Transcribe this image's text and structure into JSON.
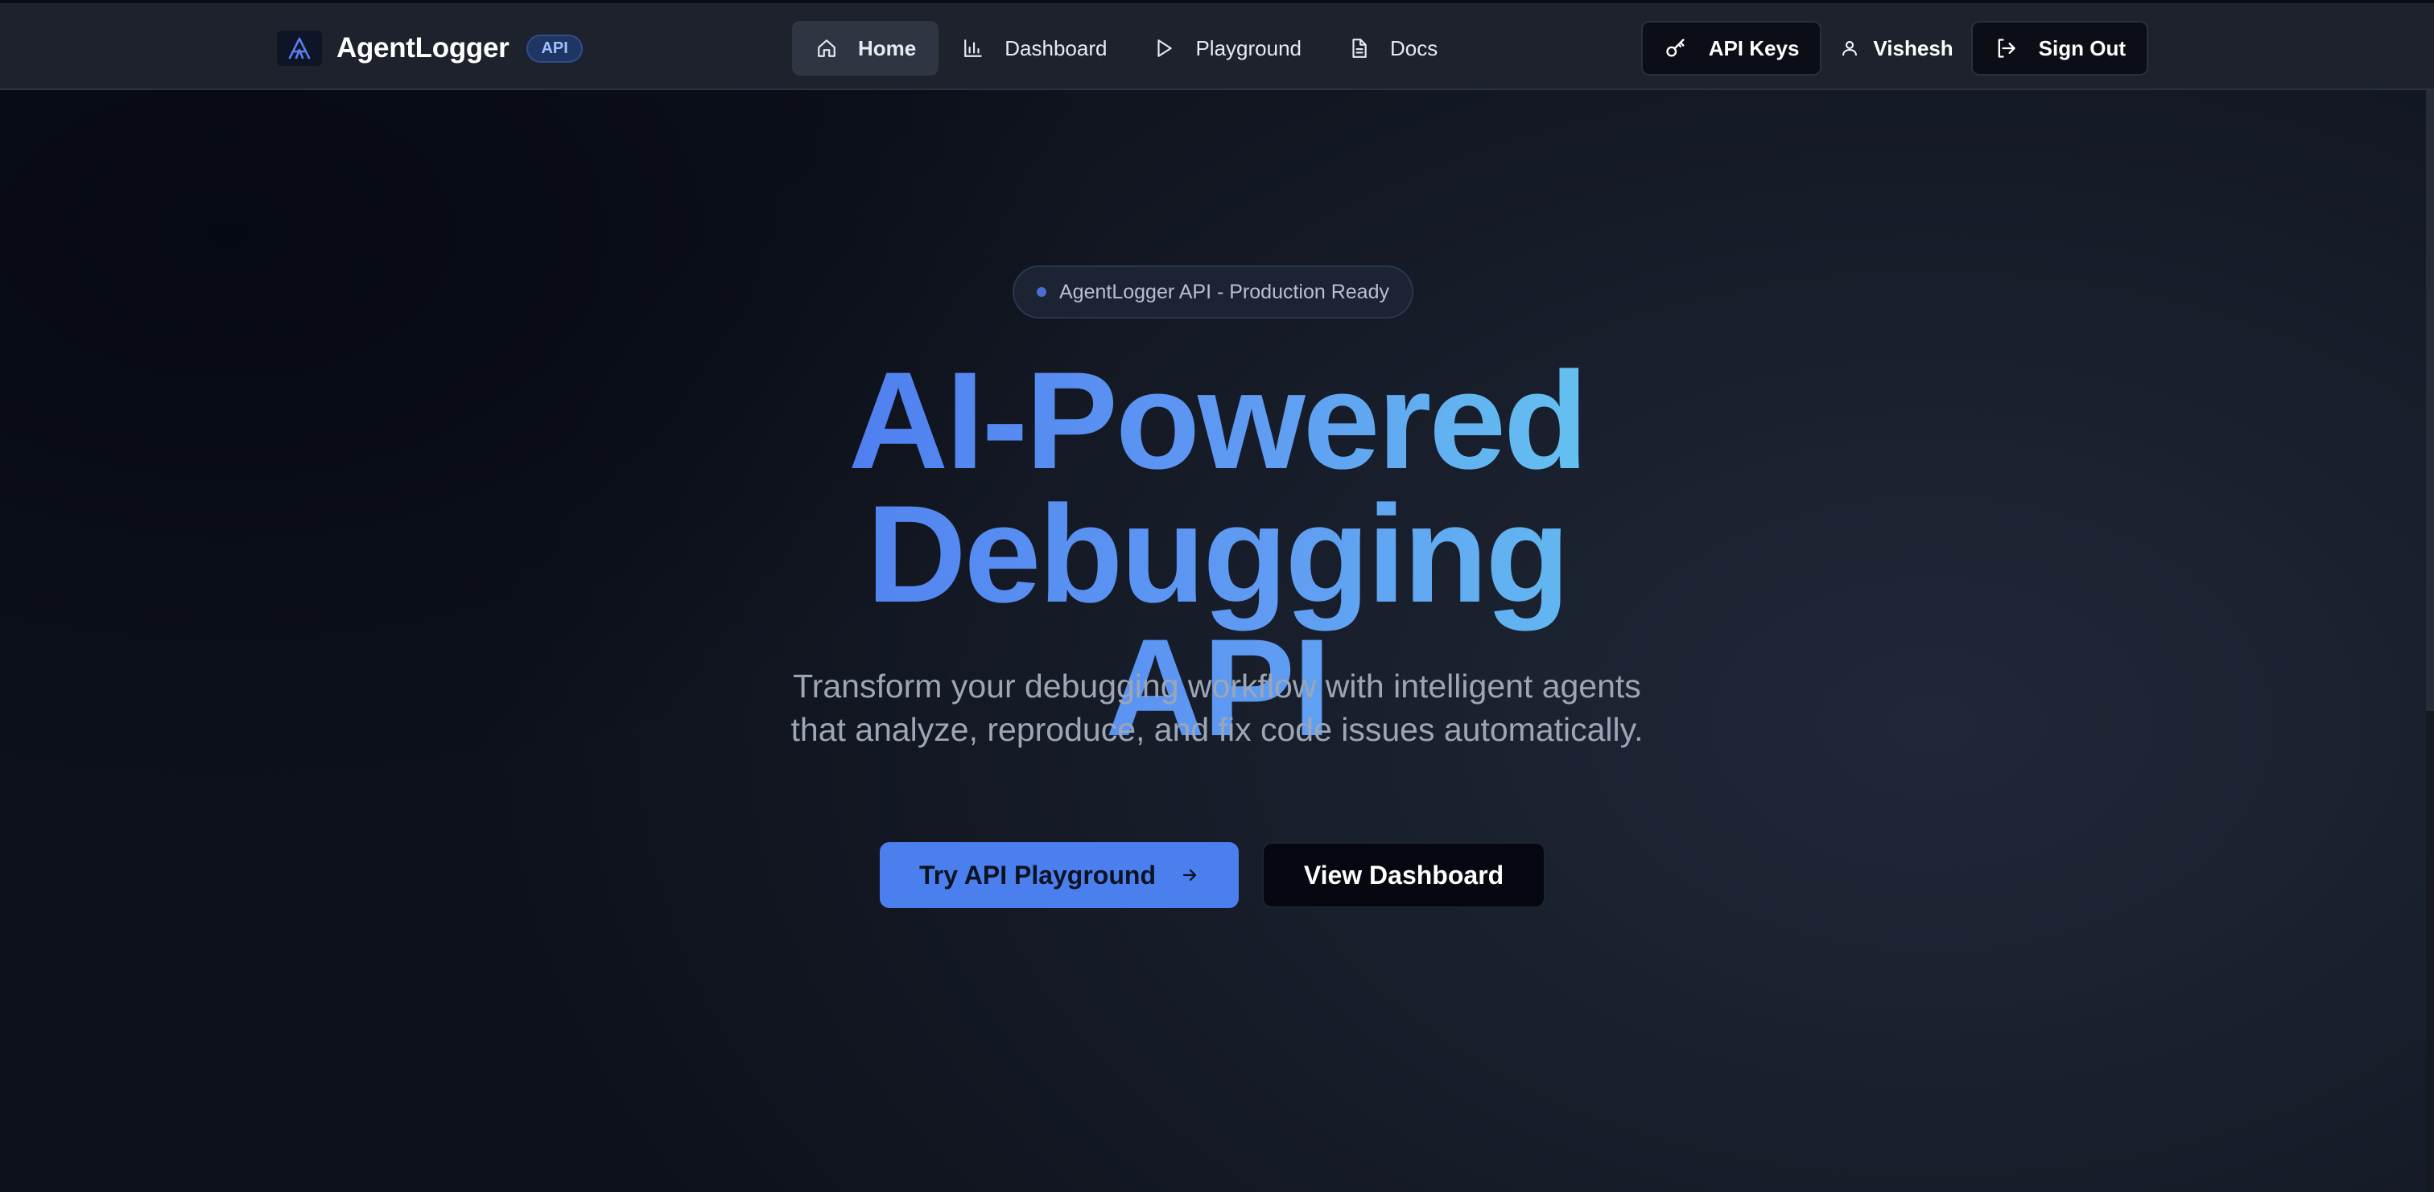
{
  "brand": {
    "name": "AgentLogger",
    "badge": "API"
  },
  "nav": {
    "items": [
      {
        "label": "Home",
        "icon": "home-icon",
        "active": true
      },
      {
        "label": "Dashboard",
        "icon": "bar-chart-icon",
        "active": false
      },
      {
        "label": "Playground",
        "icon": "play-icon",
        "active": false
      },
      {
        "label": "Docs",
        "icon": "document-icon",
        "active": false
      }
    ]
  },
  "actions": {
    "api_keys_label": "API Keys",
    "user_name": "Vishesh",
    "sign_out_label": "Sign Out"
  },
  "hero": {
    "pill_text": "AgentLogger API - Production Ready",
    "headline_line1": "AI-Powered",
    "headline_line2": "Debugging API",
    "subtitle_line1": "Transform your debugging workflow with intelligent agents",
    "subtitle_line2": "that analyze, reproduce, and fix code issues automatically.",
    "primary_cta": "Try API Playground",
    "secondary_cta": "View Dashboard"
  },
  "colors": {
    "accent": "#4c7fee",
    "gradient_start": "#4f7ff0",
    "gradient_end": "#64c1f0",
    "background": "#131824"
  }
}
